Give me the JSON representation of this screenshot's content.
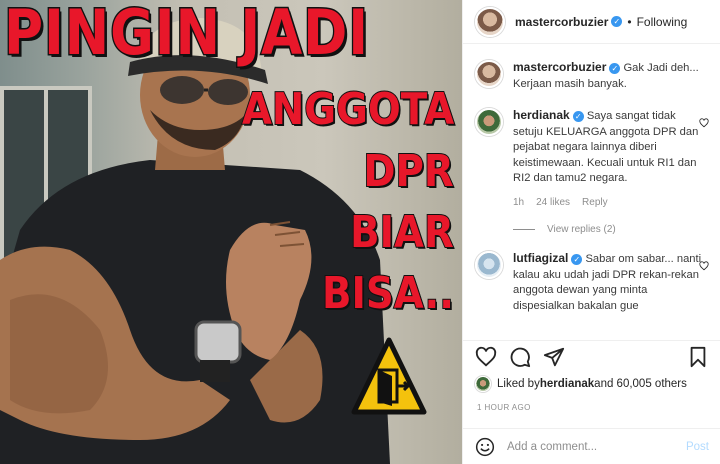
{
  "image": {
    "headline_lines": [
      "PINGIN JADI",
      "ANGGOTA",
      "DPR",
      "BIAR",
      "BISA.."
    ],
    "accent_red": "#e8172a",
    "sign_icon": "door-warning-icon"
  },
  "header": {
    "username": "mastercorbuzier",
    "separator": "•",
    "follow_status": "Following"
  },
  "comments": [
    {
      "username": "mastercorbuzier",
      "text": "Gak Jadi deh... Kerjaan masih banyak."
    },
    {
      "username": "herdianak",
      "text": "Saya sangat tidak setuju KELUARGA anggota DPR dan pejabat negara lainnya diberi keistimewaan. Kecuali untuk RI1 dan RI2 dan tamu2 negara.",
      "time": "1h",
      "likes": "24 likes",
      "reply_label": "Reply",
      "view_replies": "View replies (2)"
    },
    {
      "username": "lutfiagizal",
      "text": "Sabar om sabar... nanti kalau aku udah jadi DPR rekan-rekan anggota dewan yang minta dispesialkan bakalan gue"
    }
  ],
  "actions": {
    "icons": [
      "heart-icon",
      "comment-icon",
      "share-icon",
      "bookmark-icon"
    ]
  },
  "likes_line": {
    "prefix": "Liked by ",
    "user": "herdianak",
    "suffix": " and 60,005 others"
  },
  "timestamp": "1 HOUR AGO",
  "add_comment": {
    "placeholder": "Add a comment...",
    "post_label": "Post"
  },
  "colors": {
    "verified_blue": "#3897f0",
    "muted_text": "#8e8e8e",
    "post_button_disabled": "#b3dbff"
  }
}
